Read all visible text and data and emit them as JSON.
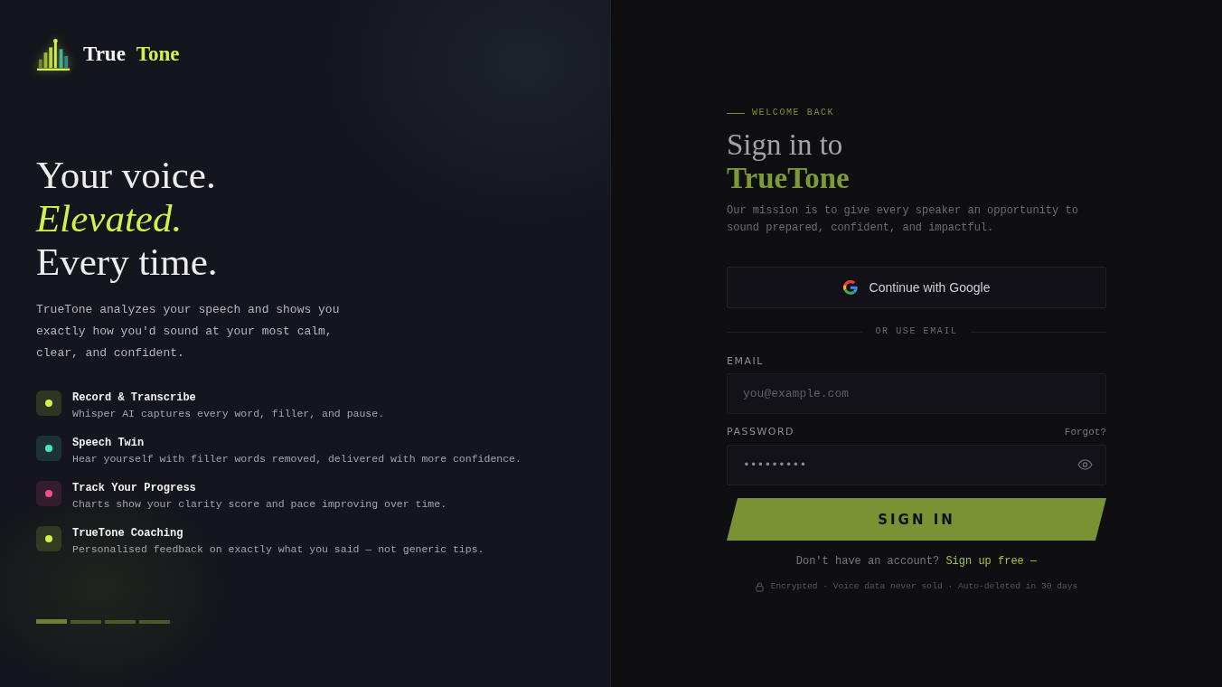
{
  "brand": {
    "parts": [
      "True",
      "Tone"
    ]
  },
  "hero": {
    "headline": [
      {
        "text": "Your voice.",
        "kind": "plain"
      },
      {
        "text": "Elevated.",
        "kind": "accent"
      },
      {
        "text": "Every time.",
        "kind": "plain"
      }
    ],
    "description": "TrueTone analyzes your speech and shows you exactly how you'd sound at your most calm, clear, and confident."
  },
  "features": [
    {
      "title": "Record & Transcribe",
      "description": "Whisper AI captures every word, filler, and pause.",
      "color": "#d4f04c"
    },
    {
      "title": "Speech Twin",
      "description": "Hear yourself with filler words removed, delivered with more confidence.",
      "color": "#4fe3c1"
    },
    {
      "title": "Track Your Progress",
      "description": "Charts show your clarity score and pace improving over time.",
      "color": "#f0508c"
    },
    {
      "title": "TrueTone Coaching",
      "description": "Personalised feedback on exactly what you said — not generic tips.",
      "color": "#d4f04c"
    }
  ],
  "slides": [
    {
      "selected": true
    },
    {
      "selected": false
    },
    {
      "selected": false
    },
    {
      "selected": false
    }
  ],
  "signin": {
    "eyebrow": "WELCOME BACK",
    "title": "Sign in to",
    "brand_name": "TrueTone",
    "mission": "Our mission is to give every speaker an opportunity to sound prepared, confident, and impactful.",
    "google_button": "Continue with Google",
    "divider": "OR USE EMAIL",
    "email": {
      "label": "EMAIL",
      "placeholder": "you@example.com"
    },
    "password": {
      "label": "PASSWORD",
      "value": "•••••••••",
      "forgot_link": "Forgot?"
    },
    "submit_button": "SIGN IN",
    "signup_prompt": "Don't have an account?",
    "signup_link": "Sign up free —",
    "security_note": "Encrypted · Voice data never sold · Auto-deleted in 30 days"
  }
}
